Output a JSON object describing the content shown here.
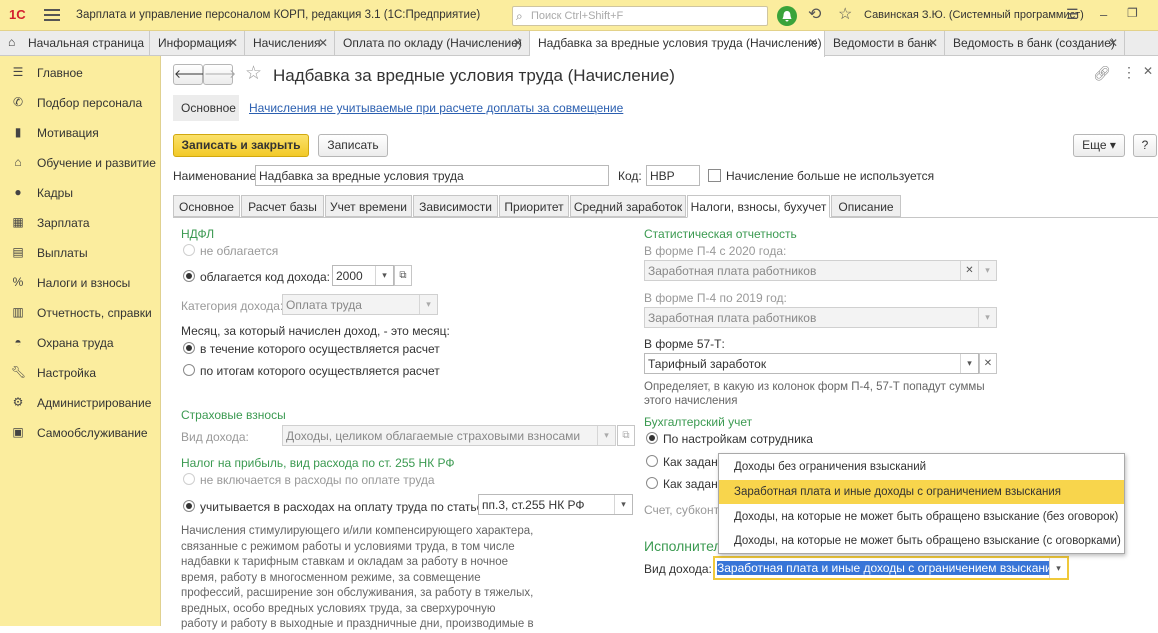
{
  "titlebar": {
    "logo": "1С",
    "title": "Зарплата и управление персоналом КОРП, редакция 3.1  (1С:Предприятие)",
    "search_placeholder": "Поиск Ctrl+Shift+F",
    "user": "Савинская З.Ю. (Системный программист)"
  },
  "tabs": [
    {
      "label": "Начальная страница",
      "closable": false
    },
    {
      "label": "Информация",
      "closable": true
    },
    {
      "label": "Начисления",
      "closable": true
    },
    {
      "label": "Оплата по окладу (Начисление)",
      "closable": true
    },
    {
      "label": "Надбавка за вредные условия труда (Начисление)",
      "closable": true,
      "active": true
    },
    {
      "label": "Ведомости в банк",
      "closable": true
    },
    {
      "label": "Ведомость в банк (создание)",
      "closable": true
    }
  ],
  "sidebar": {
    "items": [
      {
        "label": "Главное",
        "icon": "menu-icon"
      },
      {
        "label": "Подбор персонала",
        "icon": "recruiting-icon"
      },
      {
        "label": "Мотивация",
        "icon": "motivation-icon"
      },
      {
        "label": "Обучение и развитие",
        "icon": "education-icon"
      },
      {
        "label": "Кадры",
        "icon": "people-icon"
      },
      {
        "label": "Зарплата",
        "icon": "calculator-icon"
      },
      {
        "label": "Выплаты",
        "icon": "payments-icon"
      },
      {
        "label": "Налоги и взносы",
        "icon": "percent-icon"
      },
      {
        "label": "Отчетность, справки",
        "icon": "reports-icon"
      },
      {
        "label": "Охрана труда",
        "icon": "safety-icon"
      },
      {
        "label": "Настройка",
        "icon": "wrench-icon"
      },
      {
        "label": "Администрирование",
        "icon": "gear-icon"
      },
      {
        "label": "Самообслуживание",
        "icon": "self-service-icon"
      }
    ]
  },
  "form": {
    "title": "Надбавка за вредные условия труда (Начисление)",
    "subnav_main": "Основное",
    "subnav_link": "Начисления не учитываемые при расчете доплаты за совмещение",
    "save_close": "Записать и закрыть",
    "save": "Записать",
    "more": "Еще",
    "help": "?",
    "name_label": "Наименование:",
    "name_value": "Надбавка за вредные условия труда",
    "code_label": "Код:",
    "code_value": "НВР",
    "unused_label": "Начисление больше не используется",
    "tabs": [
      "Основное",
      "Расчет базы",
      "Учет времени",
      "Зависимости",
      "Приоритет",
      "Средний заработок",
      "Налоги, взносы, бухучет",
      "Описание"
    ],
    "ndfl": {
      "title": "НДФЛ",
      "not_taxed": "не облагается",
      "taxed": "облагается",
      "code_label": "код дохода:",
      "code_value": "2000",
      "category_label": "Категория дохода:",
      "category_value": "Оплата труда",
      "month_label": "Месяц, за который начислен доход, - это месяц:",
      "month_opt1": "в течение которого осуществляется расчет",
      "month_opt2": "по итогам которого осуществляется расчет"
    },
    "insurance": {
      "title": "Страховые взносы",
      "kind_label": "Вид дохода:",
      "kind_value": "Доходы, целиком облагаемые страховыми взносами"
    },
    "profit_tax": {
      "title": "Налог на прибыль, вид расхода по ст. 255 НК РФ",
      "opt1": "не включается в расходы по оплате труда",
      "opt2": "учитывается в расходах на оплату труда по статье:",
      "article_value": "пп.3, ст.255 НК РФ",
      "desc_lines": [
        "Начисления стимулирующего и/или компенсирующего характера,",
        "связанные с режимом работы и условиями труда, в том числе",
        "надбавки к тарифным ставкам и окладам за работу в ночное",
        "время, работу в многосменном режиме, за совмещение",
        "профессий, расширение зон обслуживания, за работу в тяжелых,",
        "вредных, особо вредных условиях труда, за сверхурочную",
        "работу и работу в выходные и праздничные дни, производимые в"
      ]
    },
    "stats": {
      "title": "Статистическая отчетность",
      "p4_2020_label": "В форме П-4 с 2020 года:",
      "p4_2020_value": "Заработная плата работников",
      "p4_2019_label": "В форме П-4 по 2019 год:",
      "p4_2019_value": "Заработная плата работников",
      "f57_label": "В форме 57-Т:",
      "f57_value": "Тарифный заработок",
      "note_lines": [
        "Определяет, в какую из колонок форм П-4, 57-Т попадут суммы",
        "этого начисления"
      ]
    },
    "accounting": {
      "title": "Бухгалтерский учет",
      "opt1": "По настройкам сотрудника",
      "opt2": "Как задан",
      "opt3": "Как задан",
      "account_hint": "Счет, субконто"
    },
    "executive": {
      "title": "Исполнител",
      "kind_label": "Вид дохода:",
      "kind_value": "Заработная плата и иные доходы с ограничением взыскания"
    }
  },
  "popup": {
    "items": [
      "Доходы без ограничения взысканий",
      "Заработная плата и иные доходы с ограничением взыскания",
      "Доходы, на которые не может быть обращено взыскание (без оговорок)",
      "Доходы, на которые не может быть обращено взыскание (с оговорками)"
    ],
    "selected_index": 1
  },
  "colors": {
    "accent_yellow": "#fbed9e",
    "primary_button": "#f7d23c",
    "section_green": "#3b9a51",
    "selection_blue": "#3875d7"
  }
}
